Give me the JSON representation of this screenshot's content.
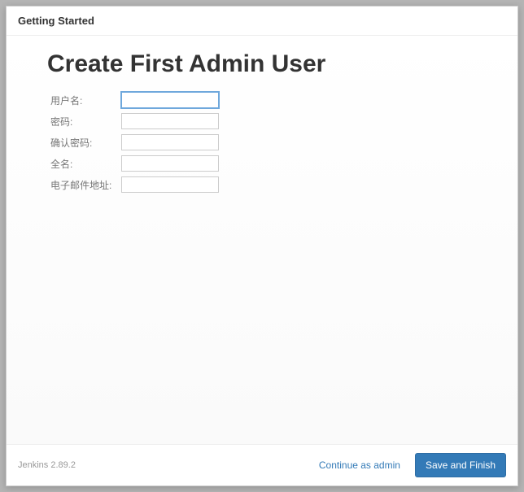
{
  "header": {
    "title": "Getting Started"
  },
  "main": {
    "heading": "Create First Admin User",
    "fields": {
      "username": {
        "label": "用户名:",
        "value": ""
      },
      "password": {
        "label": "密码:",
        "value": ""
      },
      "confirm_password": {
        "label": "确认密码:",
        "value": ""
      },
      "fullname": {
        "label": "全名:",
        "value": ""
      },
      "email": {
        "label": "电子邮件地址:",
        "value": ""
      }
    }
  },
  "footer": {
    "version": "Jenkins 2.89.2",
    "continue_label": "Continue as admin",
    "save_label": "Save and Finish"
  }
}
